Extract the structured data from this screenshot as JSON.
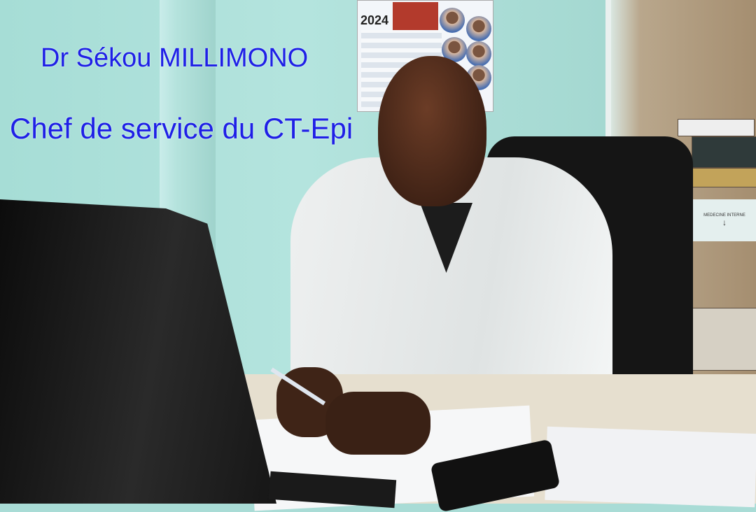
{
  "caption": {
    "name_line": "Dr Sékou MILLIMONO",
    "title_line": "Chef de service du CT-Epi",
    "color": "#1f1fe6"
  },
  "calendar": {
    "year": "2024"
  },
  "shelf_sign": {
    "text": "MEDECINE INTERNE",
    "arrow": "↓"
  }
}
